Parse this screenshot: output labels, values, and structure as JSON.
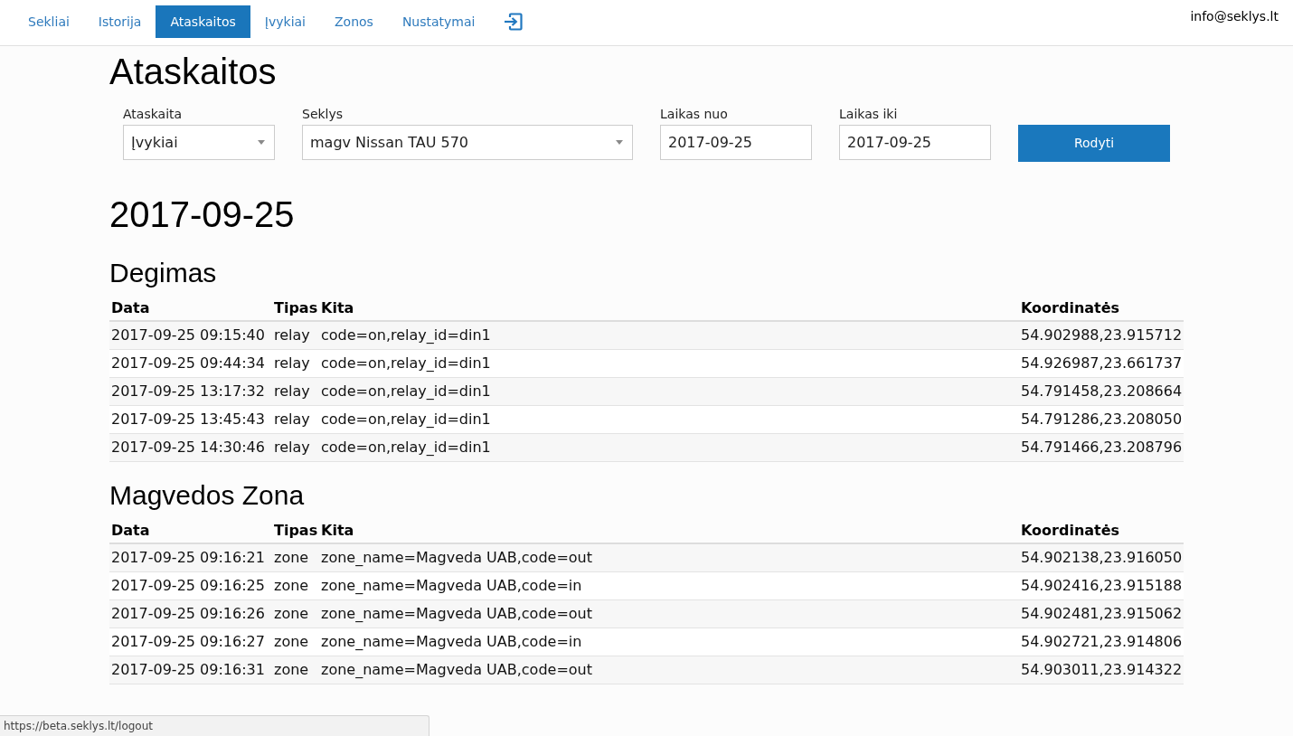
{
  "nav": {
    "items": [
      {
        "label": "Sekliai",
        "selected": false
      },
      {
        "label": "Istorija",
        "selected": false
      },
      {
        "label": "Ataskaitos",
        "selected": true
      },
      {
        "label": "Įvykiai",
        "selected": false
      },
      {
        "label": "Zonos",
        "selected": false
      },
      {
        "label": "Nustatymai",
        "selected": false
      }
    ],
    "account": "info@seklys.lt"
  },
  "page_title": "Ataskaitos",
  "filters": {
    "fields": [
      {
        "kind": "select",
        "label": "Ataskaita",
        "value": "Įvykiai"
      },
      {
        "kind": "select",
        "label": "Seklys",
        "value": "magv Nissan TAU 570"
      },
      {
        "kind": "date",
        "label": "Laikas nuo",
        "value": "2017-09-25"
      },
      {
        "kind": "date",
        "label": "Laikas iki",
        "value": "2017-09-25"
      }
    ],
    "submit": "Rodyti"
  },
  "report": {
    "date_heading": "2017-09-25",
    "sections": [
      {
        "title": "Degimas",
        "columns": [
          "Data",
          "Tipas",
          "Kita",
          "Koordinatės"
        ],
        "rows": [
          [
            "2017-09-25 09:15:40",
            "relay",
            "code=on,relay_id=din1",
            "54.902988,23.915712"
          ],
          [
            "2017-09-25 09:44:34",
            "relay",
            "code=on,relay_id=din1",
            "54.926987,23.661737"
          ],
          [
            "2017-09-25 13:17:32",
            "relay",
            "code=on,relay_id=din1",
            "54.791458,23.208664"
          ],
          [
            "2017-09-25 13:45:43",
            "relay",
            "code=on,relay_id=din1",
            "54.791286,23.208050"
          ],
          [
            "2017-09-25 14:30:46",
            "relay",
            "code=on,relay_id=din1",
            "54.791466,23.208796"
          ]
        ]
      },
      {
        "title": "Magvedos Zona",
        "columns": [
          "Data",
          "Tipas",
          "Kita",
          "Koordinatės"
        ],
        "rows": [
          [
            "2017-09-25 09:16:21",
            "zone",
            "zone_name=Magveda UAB,code=out",
            "54.902138,23.916050"
          ],
          [
            "2017-09-25 09:16:25",
            "zone",
            "zone_name=Magveda UAB,code=in",
            "54.902416,23.915188"
          ],
          [
            "2017-09-25 09:16:26",
            "zone",
            "zone_name=Magveda UAB,code=out",
            "54.902481,23.915062"
          ],
          [
            "2017-09-25 09:16:27",
            "zone",
            "zone_name=Magveda UAB,code=in",
            "54.902721,23.914806"
          ],
          [
            "2017-09-25 09:16:31",
            "zone",
            "zone_name=Magveda UAB,code=out",
            "54.903011,23.914322"
          ]
        ]
      }
    ]
  },
  "status_bar": {
    "url": "https://beta.seklys.lt/logout"
  }
}
